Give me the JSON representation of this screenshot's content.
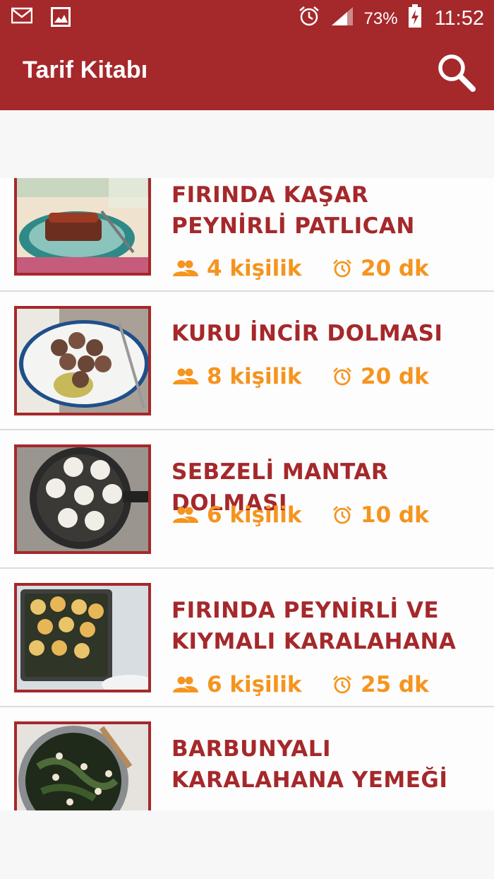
{
  "status_bar": {
    "icons_left": [
      "mail-icon",
      "image-icon"
    ],
    "battery_percent": "73%",
    "time": "11:52",
    "icons_right": [
      "alarm-icon",
      "signal-icon",
      "battery-charging-icon"
    ]
  },
  "app_bar": {
    "title": "Tarif Kitabı",
    "search_icon": "search-icon",
    "color": "#a5282b"
  },
  "recipes": [
    {
      "title": "FIRINDA KAŞAR PEYNİRLİ PATLICAN",
      "servings": "4 kişilik",
      "time": "20 dk"
    },
    {
      "title": "KURU İNCİR DOLMASI",
      "servings": "8 kişilik",
      "time": "20 dk"
    },
    {
      "title": "SEBZELİ MANTAR DOLMASI",
      "servings": "6 kişilik",
      "time": "10 dk"
    },
    {
      "title": "FIRINDA PEYNİRLİ VE KIYMALI KARALAHANA",
      "servings": "6 kişilik",
      "time": "25 dk"
    },
    {
      "title": "BARBUNYALI KARALAHANA YEMEĞİ",
      "servings": "",
      "time": ""
    }
  ],
  "colors": {
    "accent": "#a5282b",
    "meta": "#f5941e"
  }
}
